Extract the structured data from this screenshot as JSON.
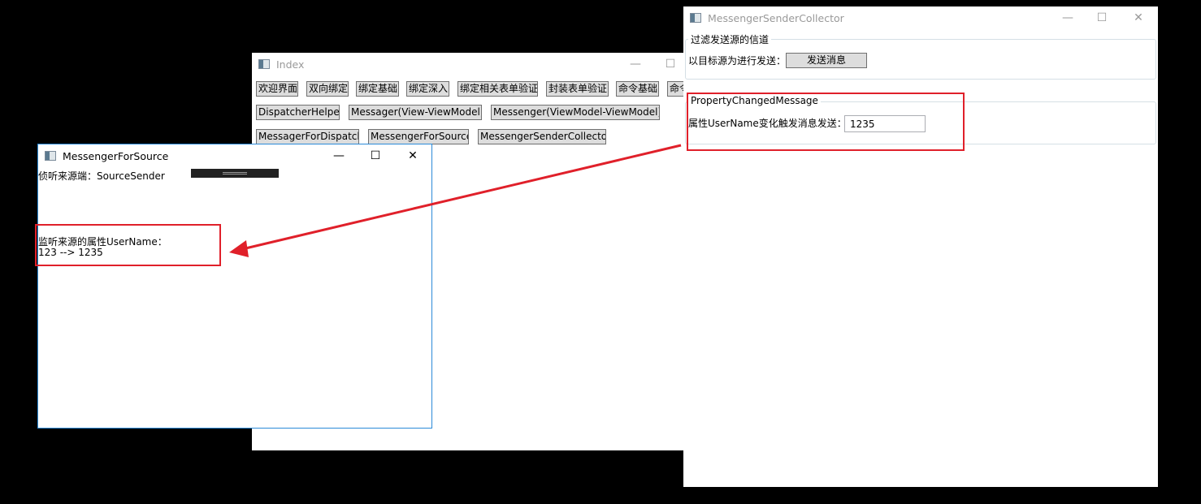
{
  "index_window": {
    "title": "Index",
    "buttons_row1": [
      "欢迎界面",
      "双向绑定",
      "绑定基础",
      "绑定深入",
      "绑定相关表单验证",
      "封装表单验证",
      "命令基础",
      "命令"
    ],
    "buttons_row2": [
      "DispatcherHelper",
      "Messager(View-ViewModel)",
      "Messenger(ViewModel-ViewModel)"
    ],
    "buttons_row3": [
      "MessagerForDispatch",
      "MessengerForSource",
      "MessengerSenderCollector"
    ],
    "minimize": "—",
    "maximize": "☐"
  },
  "source_window": {
    "title": "MessengerForSource",
    "listen_label": "侦听来源端：SourceSender",
    "property_label": "监听来源的属性UserName：",
    "property_value": "123 --> 1235",
    "minimize": "—",
    "maximize": "☐",
    "close": "✕"
  },
  "collector_window": {
    "title": "MessengerSenderCollector",
    "group1_title": "过滤发送源的信道",
    "group1_label": "以目标源为进行发送：",
    "send_button": "发送消息",
    "group2_title": "PropertyChangedMessage",
    "group2_label": "属性UserName变化触发消息发送：",
    "username_value": "1235",
    "minimize": "—",
    "maximize": "☐",
    "close": "✕"
  },
  "colors": {
    "annotation": "#e0202a",
    "active_border": "#2b8ad8"
  }
}
